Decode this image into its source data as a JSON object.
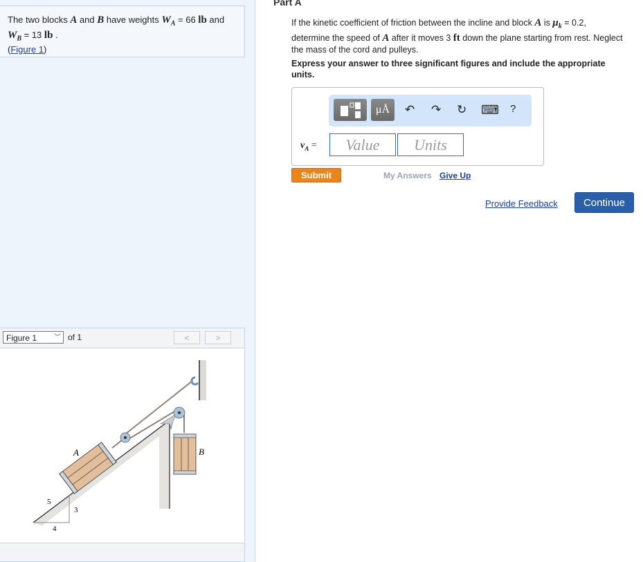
{
  "problem": {
    "text1": "The two blocks ",
    "A": "A",
    "and": " and ",
    "B": "B",
    "text2": " have weights ",
    "WA": "W",
    "WA_sub": "A",
    "eq1": " = 66 ",
    "unit1": "lb",
    "and2": " and",
    "WB": "W",
    "WB_sub": "B",
    "eq2": " = 13 ",
    "unit2": "lb",
    "period": " .",
    "figure_link": "Figure 1",
    "paren_open": "(",
    "paren_close": ")"
  },
  "figure": {
    "selector": "Figure 1",
    "of": "of 1",
    "prev": "<",
    "next": ">",
    "labels": {
      "A": "A",
      "B": "B",
      "five": "5",
      "three": "3",
      "four": "4"
    }
  },
  "part": {
    "title": "Part A",
    "q1": "If the kinetic coefficient of friction between the incline and block ",
    "qA": "A",
    "q2": " is ",
    "mu": "μ",
    "mu_sub": "k",
    "q3": " = 0.2, determine the speed of ",
    "qA2": "A",
    "q4": " after it moves 3 ",
    "ft": "ft",
    "q5": " down the plane starting from rest. Neglect the mass of the cord and pulleys.",
    "instructions": "Express your answer to three significant figures and include the appropriate units."
  },
  "answer": {
    "var": "v",
    "var_sub": "A",
    "eq": " =",
    "value_placeholder": "Value",
    "units_placeholder": "Units",
    "toolbar": {
      "templates": "templates-icon",
      "units": "μÅ",
      "undo": "↶",
      "redo": "↷",
      "reset": "↻",
      "keyboard": "⌨",
      "help": "?"
    }
  },
  "actions": {
    "submit": "Submit",
    "my_answers": "My Answers",
    "give_up": "Give Up",
    "feedback": "Provide Feedback",
    "continue": "Continue"
  },
  "colors": {
    "submit": "#e9851c",
    "continue": "#2a5ea8",
    "link": "#1a3e9a",
    "toolbar": "#d2e5fb"
  }
}
